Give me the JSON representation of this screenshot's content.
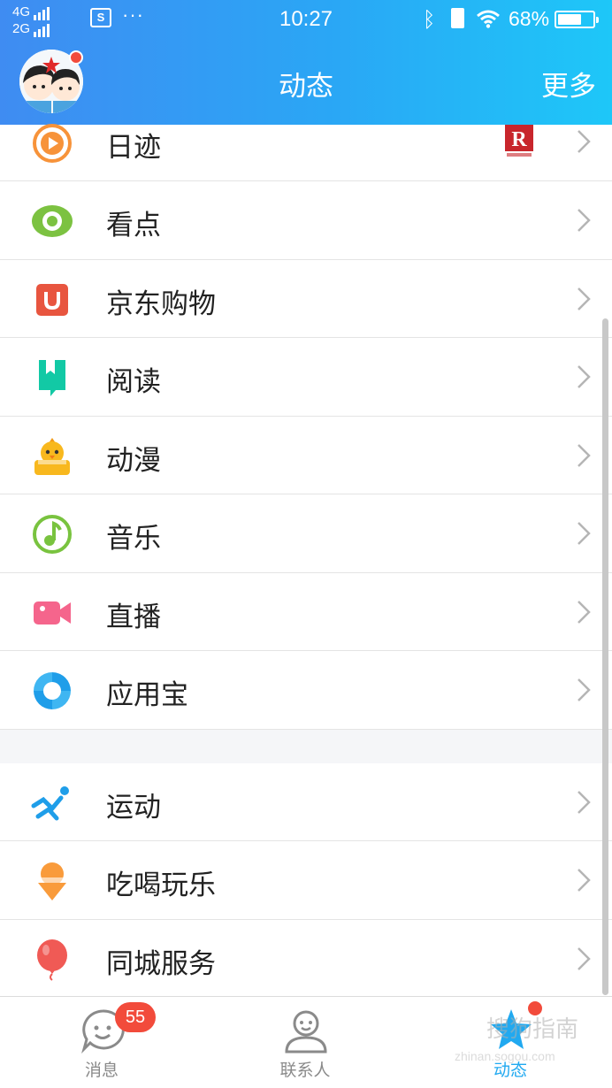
{
  "status_bar": {
    "net_top": "4G",
    "net_bottom": "2G",
    "dots": "···",
    "time": "10:27",
    "battery_pct": "68%",
    "battery_level": 0.68,
    "bluetooth": "ᛒ"
  },
  "header": {
    "title": "动态",
    "more": "更多",
    "avatar_icon": "avatar-icon"
  },
  "list": {
    "group1": [
      {
        "label": "日迹",
        "icon": "clock-play-icon",
        "color": "#f7933a"
      },
      {
        "label": "看点",
        "icon": "eye-icon",
        "color": "#7cc241"
      },
      {
        "label": "京东购物",
        "icon": "jd-bag-icon",
        "color": "#e8553f"
      },
      {
        "label": "阅读",
        "icon": "bookmark-icon",
        "color": "#12c9a5"
      },
      {
        "label": "动漫",
        "icon": "chick-icon",
        "color": "#f8b81e"
      },
      {
        "label": "音乐",
        "icon": "music-note-icon",
        "color": "#79c33f"
      },
      {
        "label": "直播",
        "icon": "video-camera-icon",
        "color": "#f5658c"
      },
      {
        "label": "应用宝",
        "icon": "app-store-icon",
        "color": "#1f9ee9"
      }
    ],
    "group2": [
      {
        "label": "运动",
        "icon": "running-icon",
        "color": "#1f9ee9"
      },
      {
        "label": "吃喝玩乐",
        "icon": "ice-cream-icon",
        "color": "#f99b3b"
      },
      {
        "label": "同城服务",
        "icon": "balloon-icon",
        "color": "#f05a55"
      }
    ]
  },
  "tabbar": {
    "messages": {
      "label": "消息",
      "badge": "55"
    },
    "contacts": {
      "label": "联系人"
    },
    "feed": {
      "label": "动态"
    }
  },
  "watermark": {
    "text": "搜狗指南",
    "url": "zhinan.sogou.com"
  },
  "colors": {
    "header_start": "#3f8cf2",
    "header_end": "#1ec7f8",
    "accent": "#21a9f0",
    "badge": "#f24b3b"
  }
}
